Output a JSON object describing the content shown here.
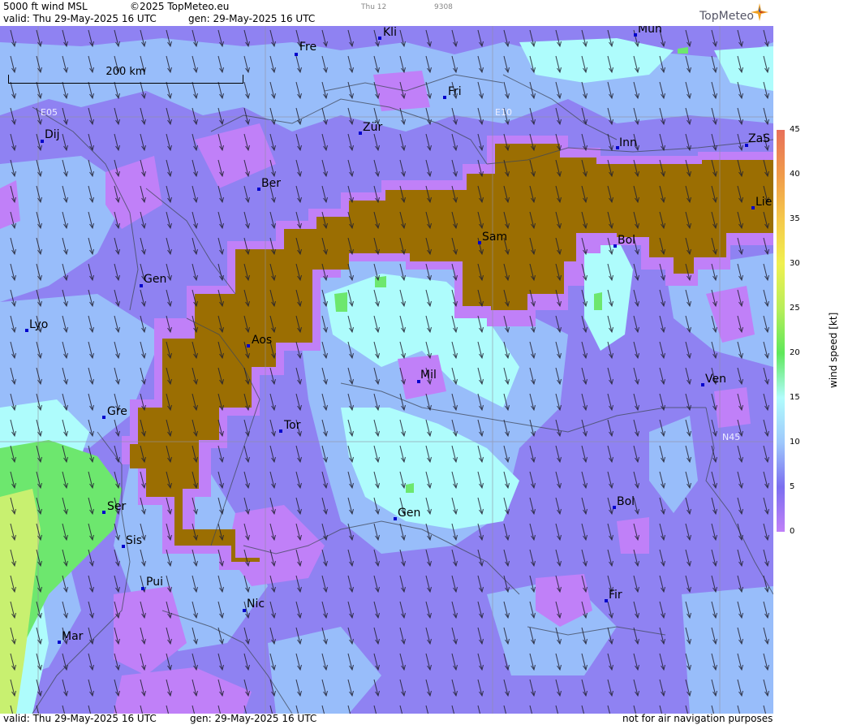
{
  "header": {
    "product": "5000 ft wind MSL",
    "copyright": "©2025 TopMeteo.eu",
    "code1": "Thu 12",
    "code2": "9308",
    "valid": "valid:  Thu  29-May-2025  16 UTC",
    "generated": "gen: 29-May-2025 16 UTC",
    "logo": "TopMeteo"
  },
  "footer": {
    "valid": "valid:  Thu  29-May-2025  16 UTC",
    "generated": "gen: 29-May-2025 16 UTC",
    "disclaimer": "not for air navigation purposes"
  },
  "scale_bar": {
    "label": "200 km"
  },
  "grid_labels": {
    "e05": "E05",
    "e10": "E10",
    "n45": "N45"
  },
  "cities": [
    {
      "name": "Kli"
    },
    {
      "name": "Mün"
    },
    {
      "name": "Fre"
    },
    {
      "name": "Fri"
    },
    {
      "name": "Dij"
    },
    {
      "name": "Zür"
    },
    {
      "name": "Inn"
    },
    {
      "name": "ZaS"
    },
    {
      "name": "Ber"
    },
    {
      "name": "Lie"
    },
    {
      "name": "Sam"
    },
    {
      "name": "Bol"
    },
    {
      "name": "Gen"
    },
    {
      "name": "Lyo"
    },
    {
      "name": "Aos"
    },
    {
      "name": "Mil"
    },
    {
      "name": "Ven"
    },
    {
      "name": "Gre"
    },
    {
      "name": "Tor"
    },
    {
      "name": "Ser"
    },
    {
      "name": "Gen"
    },
    {
      "name": "Bol"
    },
    {
      "name": "Sis"
    },
    {
      "name": "Pui"
    },
    {
      "name": "Nic"
    },
    {
      "name": "Fir"
    },
    {
      "name": "Mar"
    }
  ],
  "legend": {
    "title": "wind speed [kt]",
    "ticks": [
      "45",
      "40",
      "35",
      "30",
      "25",
      "20",
      "15",
      "10",
      "5",
      "0"
    ],
    "colors": [
      "#e8705a",
      "#f09a4a",
      "#f5c84a",
      "#f0f050",
      "#b8ee5a",
      "#5ee85a",
      "#b0fcfc",
      "#9ec8fc",
      "#7b6ef0",
      "#c080f8"
    ]
  },
  "colors": {
    "terrain": "#9b6e02",
    "calm": "#c080f8",
    "light": "#8f82f2",
    "moderate": "#98bdfa",
    "fresh": "#aefcfc",
    "strong": "#6de76e",
    "stronger": "#c8f070"
  }
}
